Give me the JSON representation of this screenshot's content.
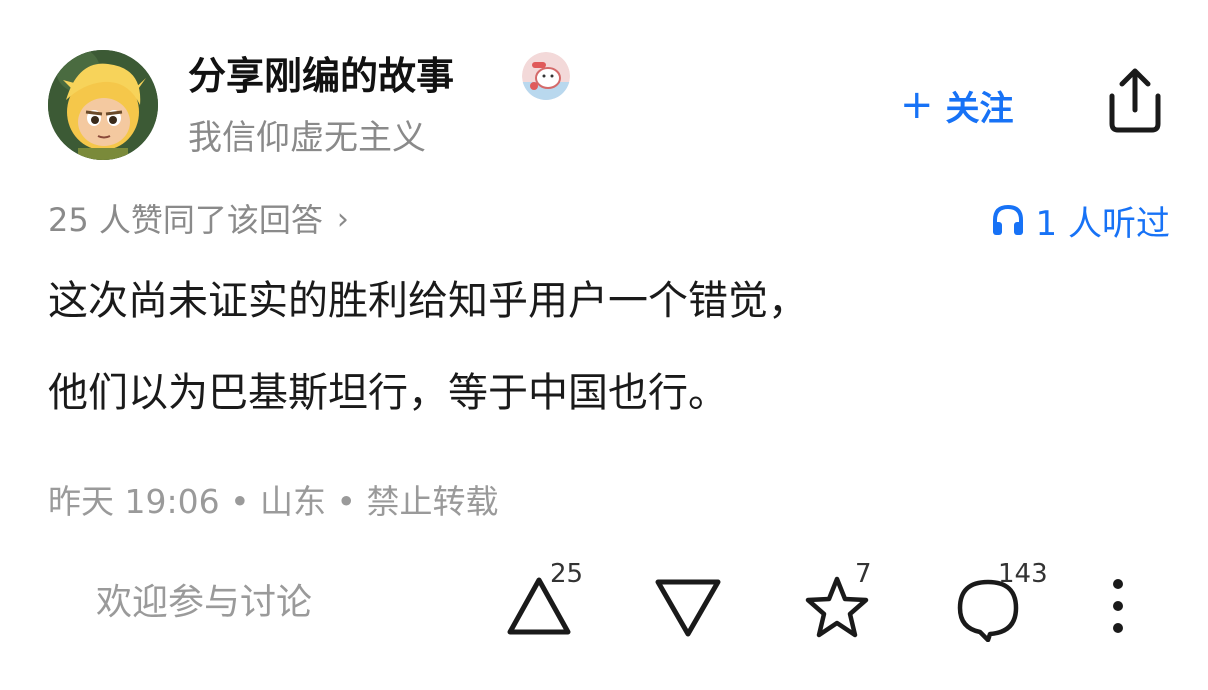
{
  "author": {
    "name": "分享刚编的故事",
    "bio": "我信仰虚无主义",
    "avatar_icon": "cartoon-avatar",
    "badge_icon": "sticker-badge"
  },
  "follow": {
    "plus": "+",
    "label": "关注"
  },
  "share_icon": "share-icon",
  "answer": {
    "upvote_summary": "25 人赞同了该回答",
    "upvote_chevron": "›",
    "listeners": "1 人听过",
    "paragraphs": [
      "这次尚未证实的胜利给知乎用户一个错觉，",
      "他们以为巴基斯坦行，等于中国也行。"
    ],
    "meta": "昨天 19:06 • 山东 • 禁止转载"
  },
  "bottom_bar": {
    "comment_placeholder": "欢迎参与讨论",
    "upvote_count": "25",
    "favorite_count": "7",
    "comment_count": "143"
  },
  "colors": {
    "accent": "#1772f6",
    "text_primary": "#1a1a1a",
    "text_secondary": "#8a8a8a"
  }
}
